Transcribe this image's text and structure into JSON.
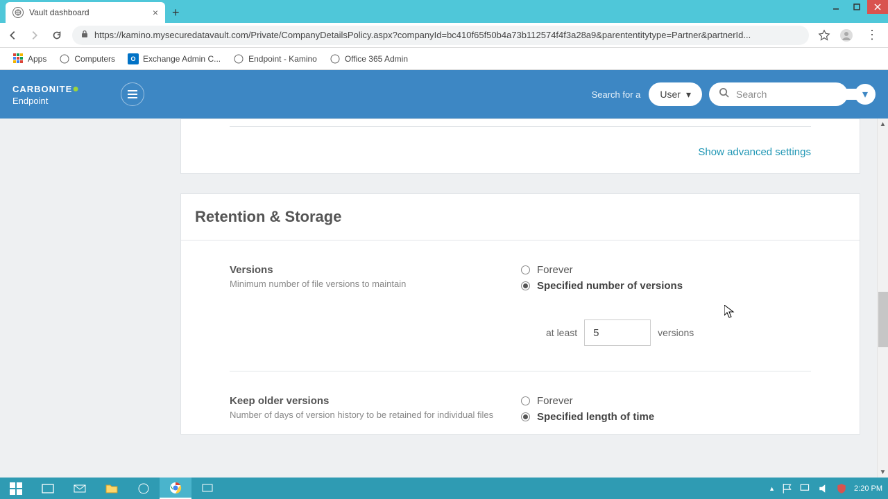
{
  "window": {
    "min": "_",
    "max": "☐",
    "close": "×"
  },
  "tab": {
    "title": "Vault dashboard"
  },
  "url": "https://kamino.mysecuredatavault.com/Private/CompanyDetailsPolicy.aspx?companyId=bc410f65f50b4a73b112574f4f3a28a9&parententitytype=Partner&partnerId...",
  "bookmarks": {
    "apps": "Apps",
    "computers": "Computers",
    "exchange": "Exchange Admin C...",
    "endpoint": "Endpoint - Kamino",
    "office": "Office 365 Admin"
  },
  "header": {
    "brand": "CARBONITE",
    "sub": "Endpoint",
    "search_for": "Search for a",
    "user_label": "User",
    "search_placeholder": "Search"
  },
  "cards": {
    "advanced": "Show advanced settings",
    "retention": {
      "title": "Retention & Storage",
      "versions": {
        "label": "Versions",
        "desc": "Minimum number of file versions to maintain",
        "opt_forever": "Forever",
        "opt_specified": "Specified number of versions",
        "atleast": "at least",
        "value": "5",
        "unit": "versions"
      },
      "keep": {
        "label": "Keep older versions",
        "desc": "Number of days of version history to be retained for individual files",
        "opt_forever": "Forever",
        "opt_specified": "Specified length of time"
      }
    }
  },
  "taskbar": {
    "time": "2:20 PM"
  }
}
